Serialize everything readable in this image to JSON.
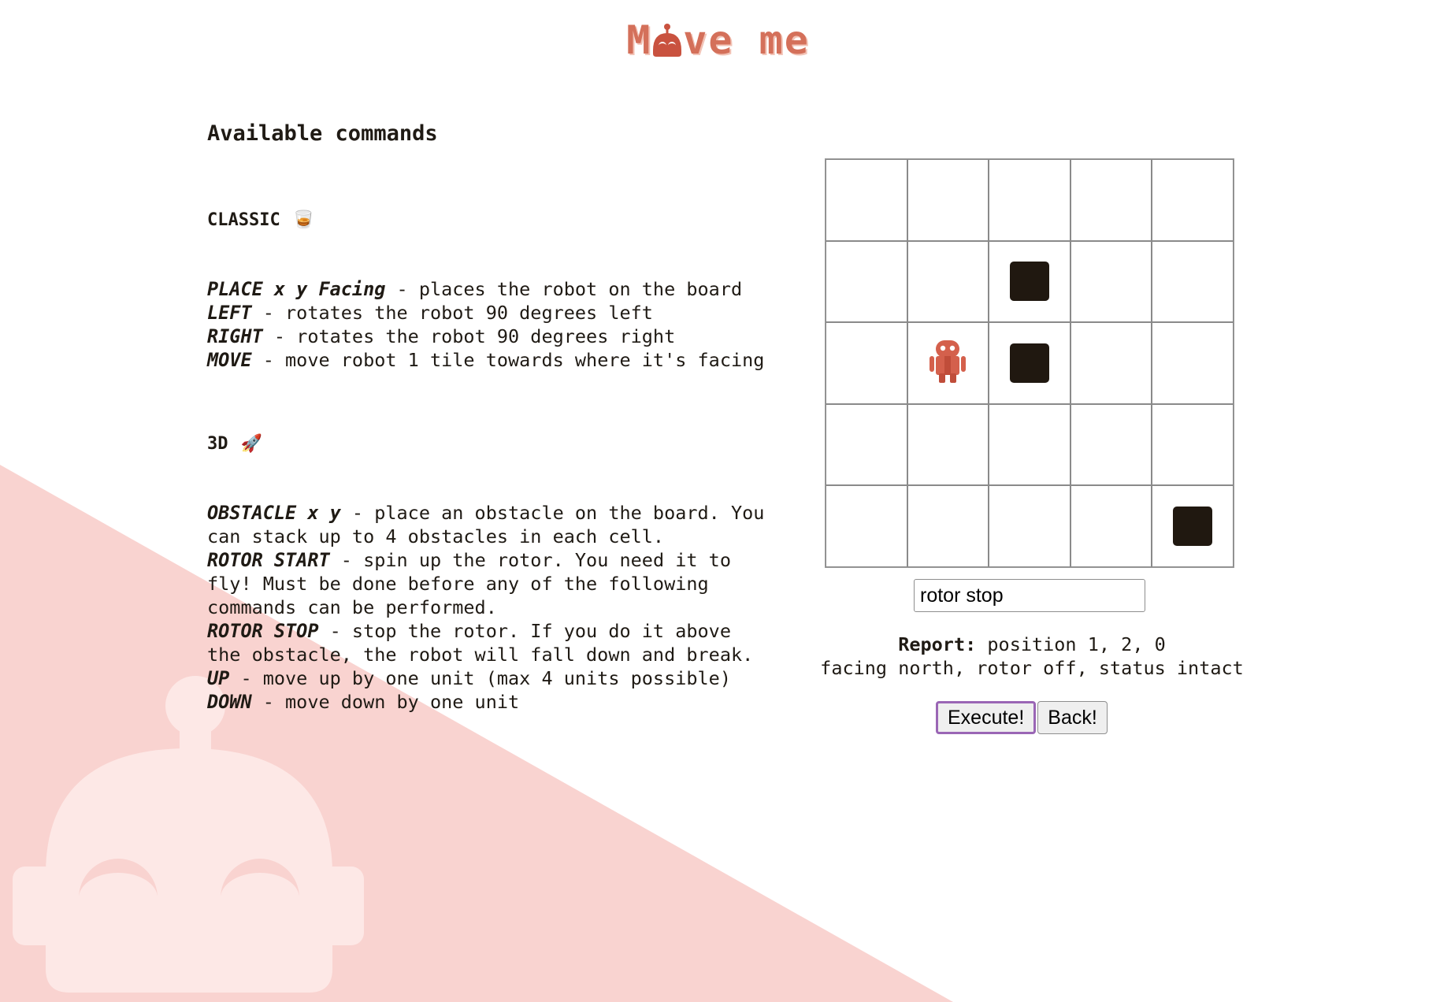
{
  "header": {
    "title_prefix": "M",
    "title_suffix": "ve me",
    "logo_icon": "robot-head-icon"
  },
  "commands": {
    "heading": "Available commands",
    "classic": {
      "title": "CLASSIC",
      "icon": "🥃",
      "items": [
        {
          "key": "PLACE x y Facing",
          "desc": " - places the robot on the board"
        },
        {
          "key": "LEFT",
          "desc": " - rotates the robot 90 degrees left"
        },
        {
          "key": "RIGHT",
          "desc": " - rotates the robot 90 degrees right"
        },
        {
          "key": "MOVE",
          "desc": " - move robot 1 tile towards where it's facing"
        }
      ]
    },
    "threed": {
      "title": "3D",
      "icon": "🚀",
      "items": [
        {
          "key": "OBSTACLE x y",
          "desc": " - place an obstacle on the board. You can stack up to 4 obstacles in each cell."
        },
        {
          "key": "ROTOR START",
          "desc": " - spin up the rotor. You need it to fly! Must be done before any of the following commands can be performed."
        },
        {
          "key": "ROTOR STOP",
          "desc": " - stop the rotor. If you do it above the obstacle, the robot will fall down and break."
        },
        {
          "key": "UP",
          "desc": " - move up by one unit (max 4 units possible)"
        },
        {
          "key": "DOWN",
          "desc": " - move down by one unit"
        }
      ]
    }
  },
  "board": {
    "rows": 5,
    "cols": 5,
    "obstacles": [
      {
        "row": 1,
        "col": 2
      },
      {
        "row": 2,
        "col": 2
      },
      {
        "row": 4,
        "col": 4
      }
    ],
    "robot": {
      "row": 2,
      "col": 1,
      "icon": "robot-icon"
    }
  },
  "input": {
    "value": "rotor stop"
  },
  "report": {
    "label": "Report:",
    "line1": " position 1, 2, 0",
    "line2": "facing north, rotor off, status intact"
  },
  "buttons": {
    "execute": "Execute!",
    "back": "Back!"
  },
  "colors": {
    "accent": "#d4705a",
    "background_pink": "#f9d3d0",
    "obstacle": "#201810",
    "execute_border": "#9a66b5"
  }
}
